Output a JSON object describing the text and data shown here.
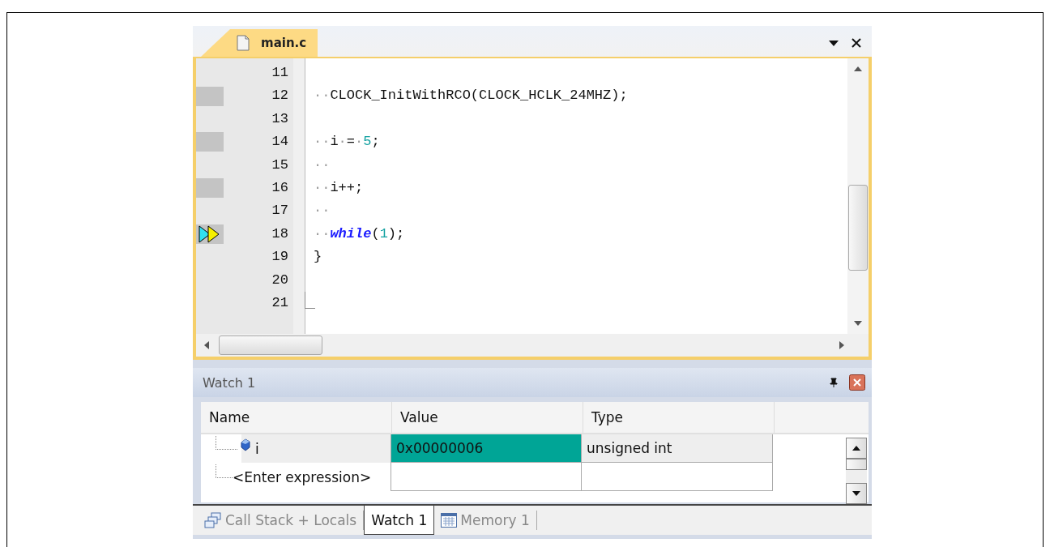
{
  "editor": {
    "tab": {
      "label": "main.c",
      "selected": true
    },
    "lines": [
      {
        "number": "11",
        "executable": false,
        "current": false
      },
      {
        "number": "12",
        "executable": true,
        "current": false,
        "tokens": [
          {
            "kind": "space",
            "text": "··"
          },
          {
            "kind": "plain",
            "text": "CLOCK_InitWithRCO(CLOCK_HCLK_24MHZ);"
          }
        ]
      },
      {
        "number": "13",
        "executable": false,
        "current": false
      },
      {
        "number": "14",
        "executable": true,
        "current": false,
        "tokens": [
          {
            "kind": "space",
            "text": "··"
          },
          {
            "kind": "plain",
            "text": "i"
          },
          {
            "kind": "space",
            "text": "·"
          },
          {
            "kind": "plain",
            "text": "="
          },
          {
            "kind": "space",
            "text": "·"
          },
          {
            "kind": "number",
            "text": "5"
          },
          {
            "kind": "plain",
            "text": ";"
          }
        ]
      },
      {
        "number": "15",
        "executable": false,
        "current": false,
        "tokens": [
          {
            "kind": "space",
            "text": "··"
          }
        ]
      },
      {
        "number": "16",
        "executable": true,
        "current": false,
        "tokens": [
          {
            "kind": "space",
            "text": "··"
          },
          {
            "kind": "plain",
            "text": "i++;"
          }
        ]
      },
      {
        "number": "17",
        "executable": false,
        "current": false,
        "tokens": [
          {
            "kind": "space",
            "text": "··"
          }
        ]
      },
      {
        "number": "18",
        "executable": true,
        "current": true,
        "tokens": [
          {
            "kind": "space",
            "text": "··"
          },
          {
            "kind": "keyword",
            "text": "while"
          },
          {
            "kind": "plain",
            "text": "("
          },
          {
            "kind": "number",
            "text": "1"
          },
          {
            "kind": "plain",
            "text": ");"
          }
        ]
      },
      {
        "number": "19",
        "executable": false,
        "current": false,
        "tokens": [
          {
            "kind": "plain",
            "text": "}"
          }
        ]
      },
      {
        "number": "20",
        "executable": false,
        "current": false
      },
      {
        "number": "21",
        "executable": false,
        "current": false
      }
    ]
  },
  "watch": {
    "title": "Watch 1",
    "columns": [
      "Name",
      "Value",
      "Type"
    ],
    "rows": [
      {
        "name": "i",
        "value": "0x00000006",
        "type": "unsigned int",
        "changed": true,
        "kind": "variable"
      },
      {
        "name": "<Enter expression>",
        "value": "",
        "type": "",
        "changed": false,
        "kind": "entry"
      }
    ],
    "tabs": [
      {
        "label": "Call Stack + Locals",
        "selected": false,
        "kind": "callstack"
      },
      {
        "label": "Watch 1",
        "selected": true,
        "kind": "watch"
      },
      {
        "label": "Memory 1",
        "selected": false,
        "kind": "memory"
      }
    ]
  }
}
